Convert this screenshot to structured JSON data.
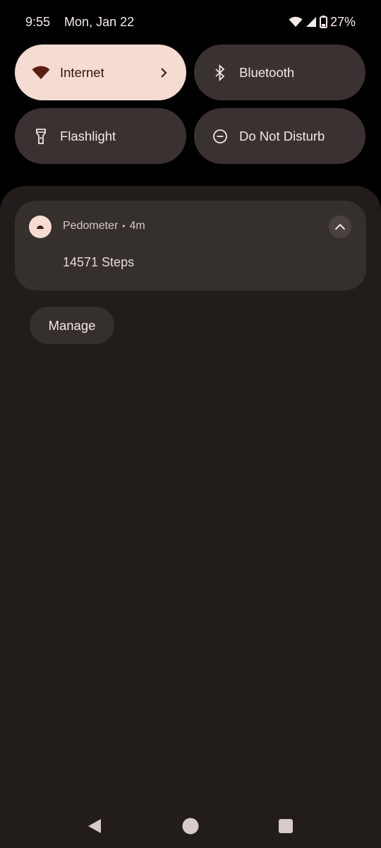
{
  "status_bar": {
    "time": "9:55",
    "date": "Mon, Jan 22",
    "battery_percent": "27%",
    "icons": [
      "wifi-icon",
      "cellular-signal-icon",
      "battery-icon"
    ]
  },
  "quick_tiles": [
    {
      "label": "Internet",
      "icon": "wifi-icon",
      "active": true,
      "has_chevron": true
    },
    {
      "label": "Bluetooth",
      "icon": "bluetooth-icon",
      "active": false
    },
    {
      "label": "Flashlight",
      "icon": "flashlight-icon",
      "active": false
    },
    {
      "label": "Do Not Disturb",
      "icon": "do-not-disturb-icon",
      "active": false
    }
  ],
  "notification": {
    "app_name": "Pedometer",
    "time_ago": "4m",
    "separator": "•",
    "body": "14571 Steps",
    "icon": "pedometer-app-icon"
  },
  "manage_button": {
    "label": "Manage"
  },
  "nav_bar": {
    "buttons": [
      "back-icon",
      "home-icon",
      "recents-icon"
    ]
  },
  "colors": {
    "background": "#000000",
    "shade": "#221c1a",
    "card": "#36302d",
    "tile_inactive": "#3a3230",
    "tile_active": "#f6dbd3",
    "accent_dark": "#5a1e12"
  }
}
